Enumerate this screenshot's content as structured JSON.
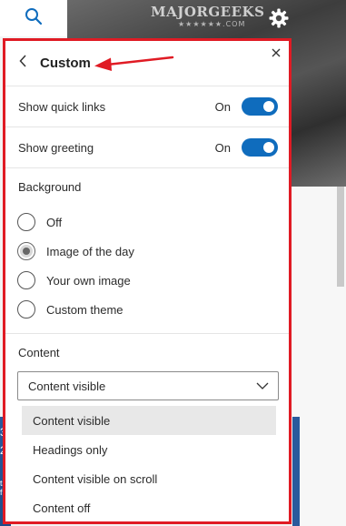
{
  "background_page": {
    "watermark": "MAJORGEEKS",
    "watermark_sub": "★★★★★★.COM",
    "strip_texts": [
      "38",
      "28",
      "ta f"
    ]
  },
  "panel": {
    "title": "Custom",
    "close_label": "×",
    "border_color": "#e01b24",
    "accent_color": "#0f6cbd",
    "toggles": [
      {
        "label": "Show quick links",
        "state": "On"
      },
      {
        "label": "Show greeting",
        "state": "On"
      }
    ],
    "background": {
      "label": "Background",
      "options": [
        {
          "label": "Off",
          "selected": false
        },
        {
          "label": "Image of the day",
          "selected": true
        },
        {
          "label": "Your own image",
          "selected": false
        },
        {
          "label": "Custom theme",
          "selected": false
        }
      ]
    },
    "content": {
      "label": "Content",
      "selected_value": "Content visible",
      "options": [
        {
          "label": "Content visible",
          "highlighted": true
        },
        {
          "label": "Headings only",
          "highlighted": false
        },
        {
          "label": "Content visible on scroll",
          "highlighted": false
        },
        {
          "label": "Content off",
          "highlighted": false
        }
      ]
    }
  },
  "icons": {
    "search": "search-icon",
    "settings": "gear-icon",
    "back": "chevron-left-icon",
    "close": "close-icon",
    "dropdown": "chevron-down-icon",
    "annotation": "red-arrow-icon"
  }
}
